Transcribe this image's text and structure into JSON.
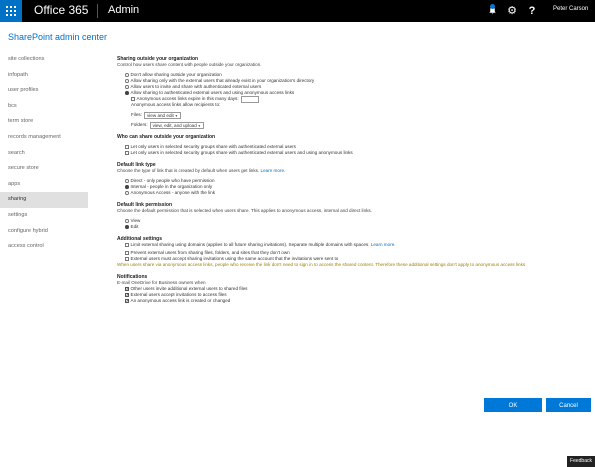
{
  "topbar": {
    "brand": "Office 365",
    "app": "Admin",
    "user": "Peter Carson",
    "help_glyph": "?",
    "icons": [
      "waffle-icon",
      "bell-icon",
      "gear-icon",
      "help-icon"
    ]
  },
  "app_title": "SharePoint admin center",
  "sidebar": {
    "items": [
      {
        "label": "site collections"
      },
      {
        "label": "infopath"
      },
      {
        "label": "user profiles"
      },
      {
        "label": "bcs"
      },
      {
        "label": "term store"
      },
      {
        "label": "records management"
      },
      {
        "label": "search"
      },
      {
        "label": "secure store"
      },
      {
        "label": "apps"
      },
      {
        "label": "sharing"
      },
      {
        "label": "settings"
      },
      {
        "label": "configure hybrid"
      },
      {
        "label": "access control"
      }
    ],
    "active": "sharing"
  },
  "sharing_outside": {
    "title": "Sharing outside your organization",
    "desc": "Control how users share content with people outside your organization.",
    "options": [
      "Don't allow sharing outside your organization",
      "Allow sharing only with the external users that already exist in your organization's directory",
      "Allow users to invite and share with authenticated external users",
      "Allow sharing to authenticated external users and using anonymous access links"
    ],
    "selected_index": 3,
    "expire_label": "Anonymous access links expire in this many days:",
    "expire_value": "",
    "allow_label": "Anonymous access links allow recipients to:",
    "files_label": "Files:",
    "files_value": "view and edit",
    "folders_label": "Folders:",
    "folders_value": "view, edit, and upload"
  },
  "who_can_share": {
    "title": "Who can share outside your organization",
    "options": [
      "Let only users in selected security groups share with authenticated external users",
      "Let only users in selected security groups share with authenticated external users and using anonymous links"
    ]
  },
  "default_link_type": {
    "title": "Default link type",
    "desc": "Choose the type of link that is created by default when users get links.",
    "learn_more": "Learn more.",
    "options": [
      "Direct - only people who have permission",
      "Internal - people in the organization only",
      "Anonymous Access - anyone with the link"
    ],
    "selected_index": 1
  },
  "default_link_permission": {
    "title": "Default link permission",
    "desc": "Choose the default permission that is selected when users share. This applies to anonymous access, internal and direct links.",
    "options": [
      "View",
      "Edit"
    ],
    "selected_index": 1
  },
  "additional": {
    "title": "Additional settings",
    "opt1": "Limit external sharing using domains (applies to all future sharing invitations). Separate multiple domains with spaces.",
    "opt1_link": "Learn more.",
    "opt2": "Prevent external users from sharing files, folders, and sites that they don't own",
    "opt3": "External users must accept sharing invitations using the same account that the invitations were sent to",
    "warning": "When users share via anonymous access links, people who receive the link don't need to sign in to access the shared content. Therefore these additional settings don't apply to anonymous access links."
  },
  "notifications": {
    "title": "Notifications",
    "desc": "E-mail OneDrive for Business owners when",
    "options": [
      {
        "label": "Other users invite additional external users to shared files",
        "checked": true
      },
      {
        "label": "External users accept invitations to access files",
        "checked": true
      },
      {
        "label": "An anonymous access link is created or changed",
        "checked": true
      }
    ]
  },
  "buttons": {
    "ok": "OK",
    "cancel": "Cancel"
  },
  "feedback": "Feedback",
  "colors": {
    "accent": "#0072c6",
    "button": "#0078d7",
    "warning": "#a08000"
  }
}
